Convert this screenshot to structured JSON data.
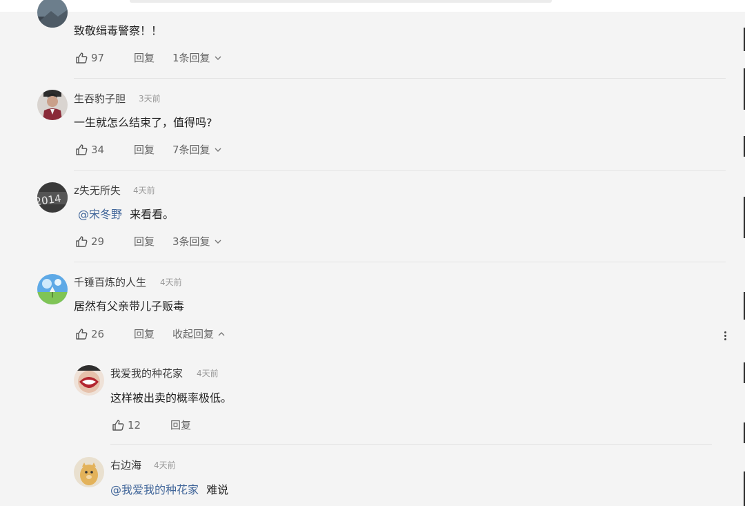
{
  "labels": {
    "reply": "回复"
  },
  "comments": [
    {
      "text": "致敬缉毒警察！！",
      "likes": "97",
      "toggle": "1条回复"
    },
    {
      "user": "生吞豹子胆",
      "time": "3天前",
      "text": "一生就怎么结束了，值得吗?",
      "likes": "34",
      "toggle": "7条回复"
    },
    {
      "user": "z失无所失",
      "time": "4天前",
      "mention": "@宋冬野",
      "text": "来看看。",
      "likes": "29",
      "toggle": "3条回复"
    },
    {
      "user": "千锤百炼的人生",
      "time": "4天前",
      "text": "居然有父亲带儿子贩毒",
      "likes": "26",
      "toggle": "收起回复"
    }
  ],
  "replies": [
    {
      "user": "我爱我的种花家",
      "time": "4天前",
      "text": "这样被出卖的概率极低。",
      "likes": "12"
    },
    {
      "user": "右边海",
      "time": "4天前",
      "mention": "@我爱我的种花家",
      "text": "难说"
    }
  ],
  "avatar_photo_text": "2014",
  "icons": {
    "like": "thumbs-up-icon",
    "expand": "chevron-down-icon",
    "collapse": "chevron-up-icon",
    "more": "more-vertical-icon"
  },
  "colors": {
    "mention": "#406599",
    "background": "#f4f4f4"
  }
}
